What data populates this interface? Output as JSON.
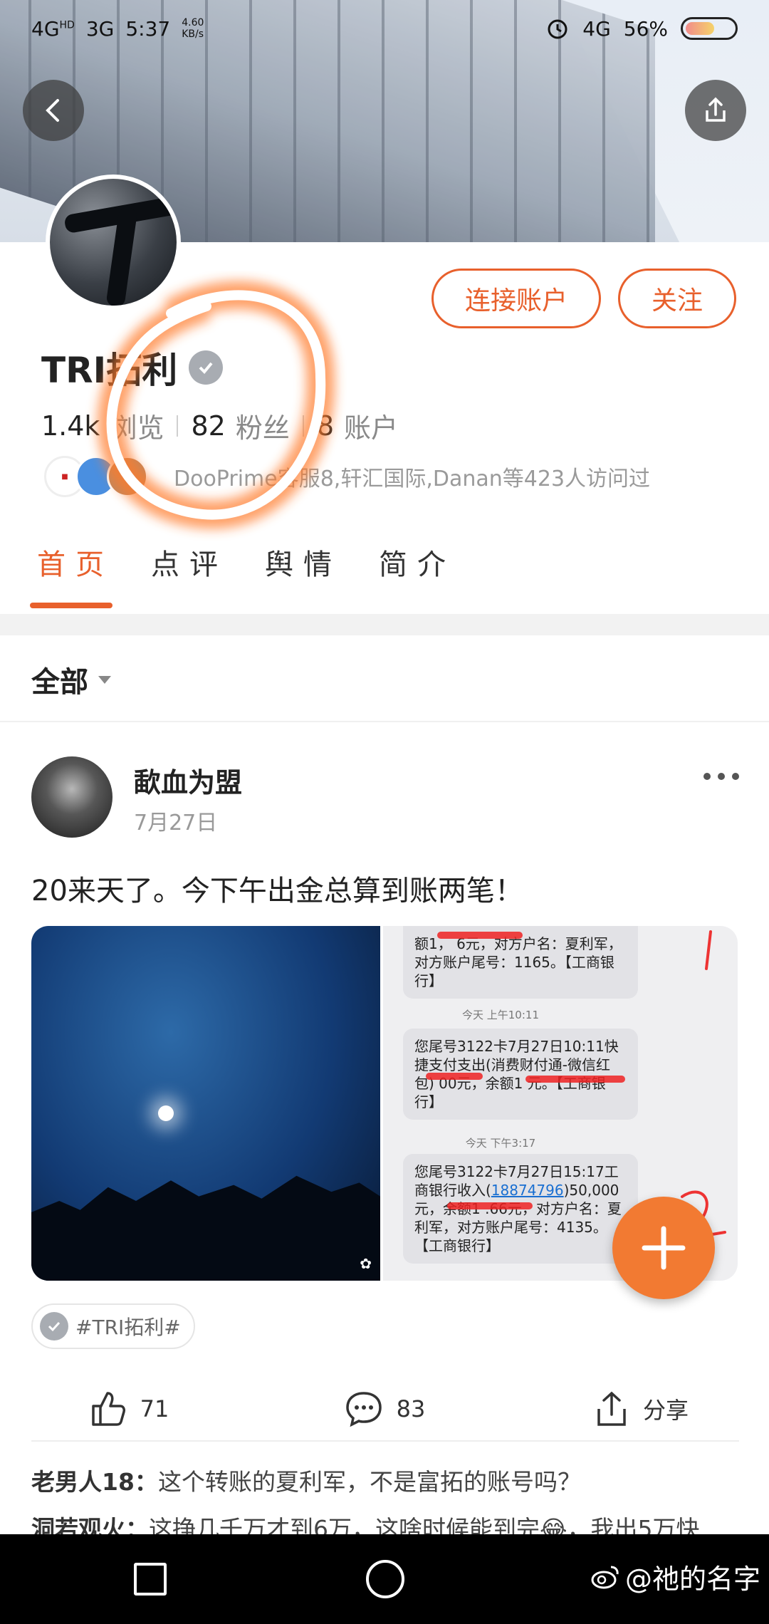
{
  "status_bar": {
    "network_left": "4G",
    "network_left_sup": "HD",
    "network_mid": "3G",
    "time": "5:37",
    "speed_value": "4.60",
    "speed_unit": "KB/s",
    "network_right": "4G",
    "battery": "56%"
  },
  "header": {
    "back_icon": "back-arrow-icon",
    "share_icon": "share-upload-icon"
  },
  "profile": {
    "name": "TRI拓利",
    "connect_label": "连接账户",
    "follow_label": "关注",
    "views_value": "1.4k",
    "views_label": "浏览",
    "fans_value": "82",
    "fans_label": "粉丝",
    "accounts_value": "8",
    "accounts_label": "账户",
    "visitors_text": "DooPrime客服8,轩汇国际,Danan等423人访问过"
  },
  "tabs": [
    {
      "label": "首页"
    },
    {
      "label": "点评"
    },
    {
      "label": "舆情"
    },
    {
      "label": "简介"
    }
  ],
  "filter": {
    "label": "全部"
  },
  "post": {
    "author": "歃血为盟",
    "date": "7月27日",
    "text": "20来天了。今下午出金总算到账两笔！",
    "sms": {
      "msg1": "额1，        6元，对方户名：夏利军，对方账户尾号：1165。【工商银行】",
      "meta2": "今天 上午10:11",
      "msg2": "您尾号3122卡7月27日10:11快捷支付支出(消费财付通-微信红包)      00元，余额1            元。【工商银行】",
      "meta3": "今天 下午3:17",
      "msg3_a": "您尾号3122卡7月27日15:17工商银行收入(",
      "msg3_link": "18874796",
      "msg3_b": ")50,000元，余额1            .66元，对方户名：夏利军，对方账户尾号：4135。【工商银行】"
    },
    "tag": "#TRI拓利#",
    "likes": "71",
    "comments": "83",
    "share_label": "分享"
  },
  "comments": [
    {
      "user": "老男人18：",
      "text": "这个转账的夏利军，不是富拓的账号吗？"
    },
    {
      "user": "洞若观火：",
      "text": "这挣几千万才到6万，这啥时候能到完😂，我出5万快"
    }
  ],
  "watermark": "@祂的名字",
  "colors": {
    "accent": "#e8602c",
    "fab": "#f27a32"
  }
}
